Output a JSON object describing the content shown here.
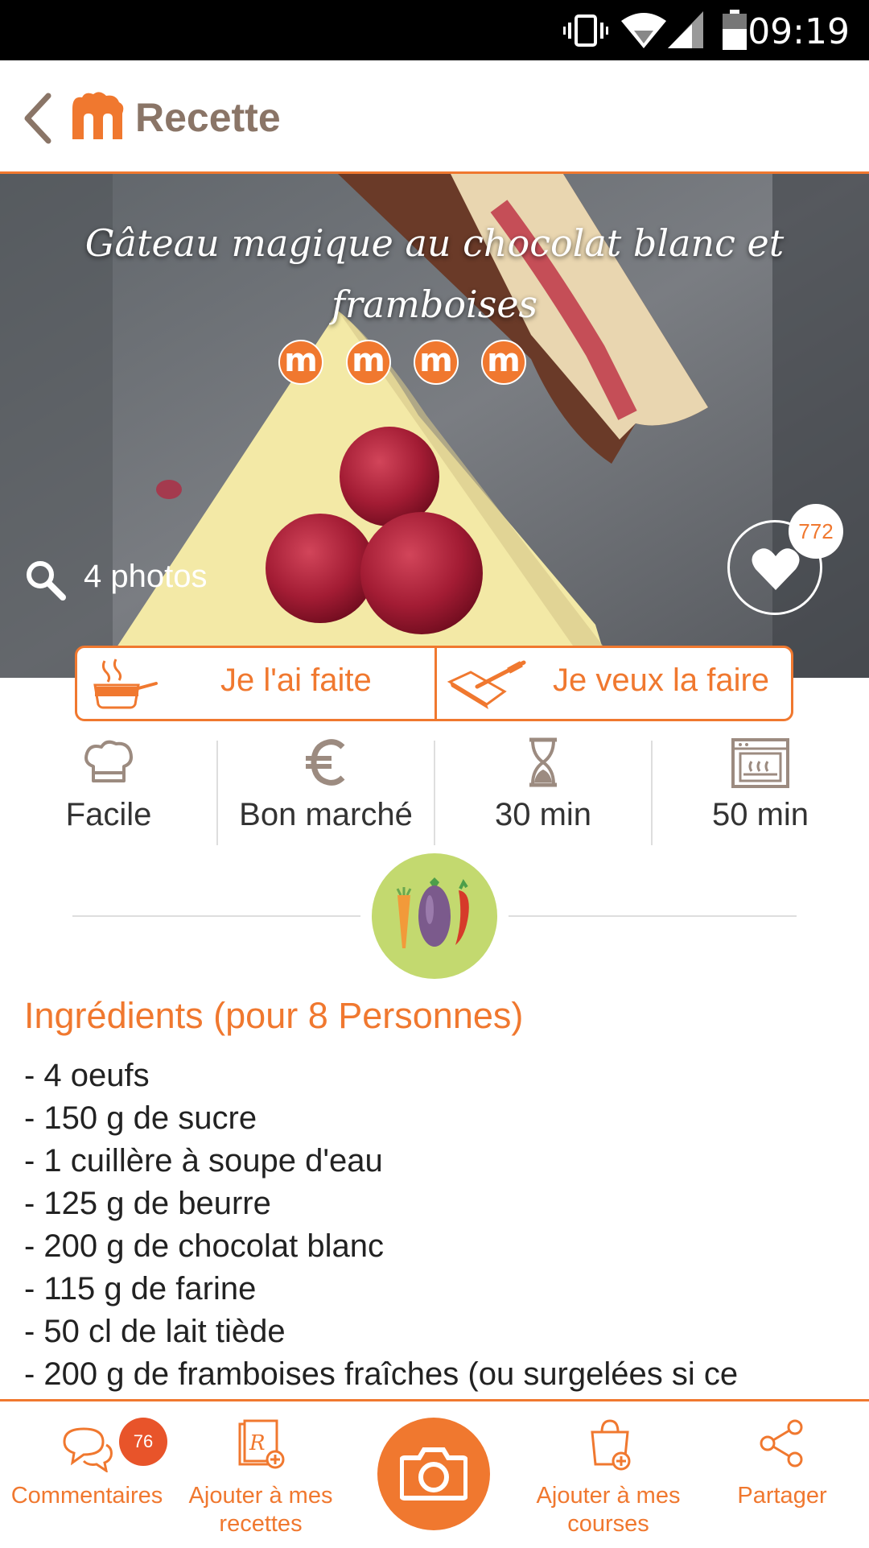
{
  "status_bar": {
    "time": "09:19",
    "icons": [
      "vibrate-icon",
      "wifi-icon",
      "signal-icon",
      "battery-icon"
    ]
  },
  "app_bar": {
    "title": "Recette",
    "back_icon": "chevron-left-icon",
    "logo_icon": "marmiton-logo-icon"
  },
  "recipe": {
    "title": "Gâteau magique au chocolat blanc et framboises",
    "rating_icons": [
      "m",
      "m",
      "m",
      "m"
    ],
    "photos_label": "4 photos",
    "favorites_count": "772"
  },
  "actions": {
    "made_label": "Je l'ai faite",
    "want_label": "Je veux la faire"
  },
  "info": [
    {
      "icon": "chef-hat-icon",
      "label": "Facile"
    },
    {
      "icon": "euro-icon",
      "label": "Bon marché"
    },
    {
      "icon": "hourglass-icon",
      "label": "30 min"
    },
    {
      "icon": "oven-icon",
      "label": "50 min"
    }
  ],
  "ingredients": {
    "title": "Ingrédients (pour 8 Personnes)",
    "items": [
      "- 4 oeufs",
      "- 150 g de sucre",
      "- 1 cuillère à soupe d'eau",
      "- 125 g de beurre",
      "- 200 g de chocolat blanc",
      "- 115 g de farine",
      "- 50 cl de lait tiède",
      "- 200 g de framboises fraîches (ou surgelées si ce"
    ]
  },
  "bottom_bar": {
    "comments_label": "Commentaires",
    "comments_count": "76",
    "add_recipes_label": "Ajouter à mes recettes",
    "add_shopping_label": "Ajouter à mes courses",
    "share_label": "Partager"
  },
  "colors": {
    "accent": "#f0782f",
    "title_grey": "#8a7567",
    "season_green": "#c3d96f"
  }
}
